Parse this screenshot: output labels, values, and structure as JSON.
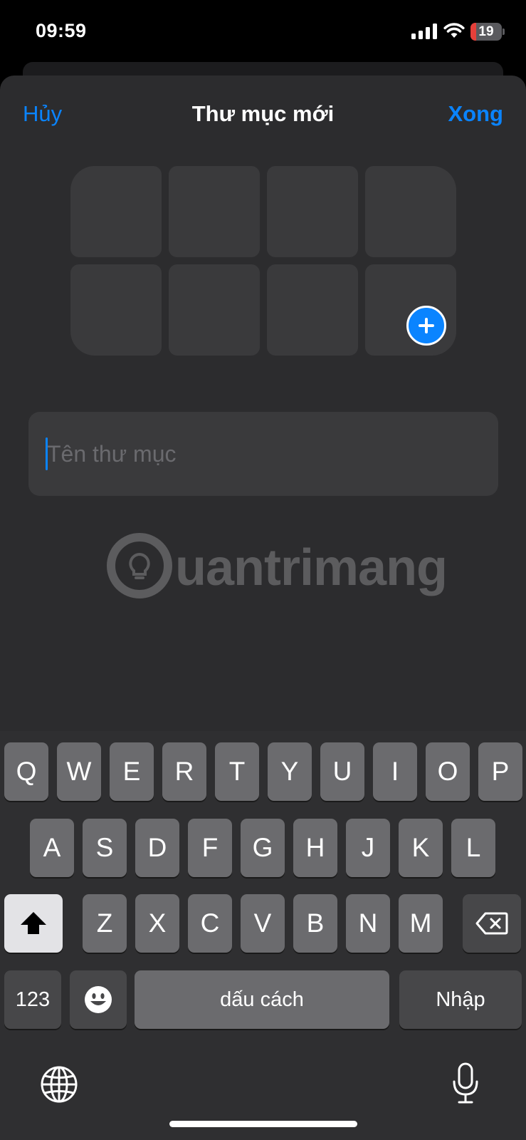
{
  "status_bar": {
    "time": "09:59",
    "battery_level": "19",
    "battery_fraction": 0.19,
    "battery_color": "#e5403a"
  },
  "header": {
    "cancel_label": "Hủy",
    "title": "Thư mục mới",
    "done_label": "Xong"
  },
  "colors": {
    "accent": "#0a84ff",
    "sheet_background": "#2c2c2e",
    "tile_background": "#3a3a3c"
  },
  "folder_preview": {
    "add_icon": "plus-circle-icon"
  },
  "name_field": {
    "placeholder": "Tên thư mục",
    "value": ""
  },
  "watermark": {
    "text": "uantrimang",
    "icon": "lightbulb-icon"
  },
  "keyboard": {
    "row1": [
      "Q",
      "W",
      "E",
      "R",
      "T",
      "Y",
      "U",
      "I",
      "O",
      "P"
    ],
    "row2": [
      "A",
      "S",
      "D",
      "F",
      "G",
      "H",
      "J",
      "K",
      "L"
    ],
    "row3": [
      "Z",
      "X",
      "C",
      "V",
      "B",
      "N",
      "M"
    ],
    "shift_icon": "shift-arrow-icon",
    "delete_icon": "backspace-icon",
    "numbers_label": "123",
    "emoji_icon": "emoji-icon",
    "space_label": "dấu cách",
    "return_label": "Nhập",
    "globe_icon": "globe-icon",
    "mic_icon": "microphone-icon"
  }
}
